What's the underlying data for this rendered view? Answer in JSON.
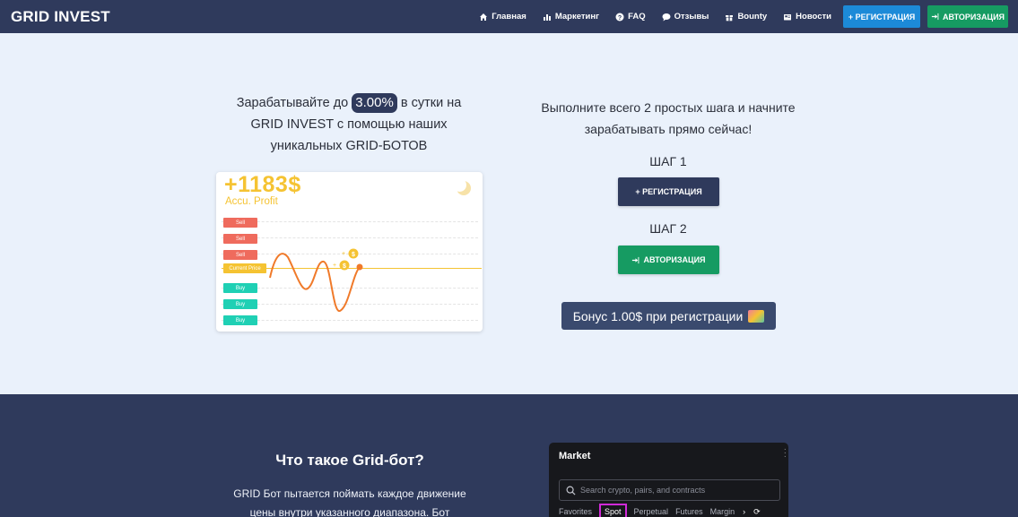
{
  "navbar": {
    "brand": "GRID INVEST",
    "links": [
      {
        "label": "Главная",
        "icon": "home-icon"
      },
      {
        "label": "Маркетинг",
        "icon": "bar-chart-icon"
      },
      {
        "label": "FAQ",
        "icon": "question-icon"
      },
      {
        "label": "Отзывы",
        "icon": "comment-icon"
      },
      {
        "label": "Bounty",
        "icon": "gift-icon"
      },
      {
        "label": "Новости",
        "icon": "newspaper-icon"
      }
    ],
    "register_label": "+ РЕГИСТРАЦИЯ",
    "login_label": "АВТОРИЗАЦИЯ"
  },
  "hero": {
    "earn_prefix": "Зарабатывайте до",
    "earn_percent": "3.00%",
    "earn_suffix": "в сутки на",
    "earn_line2": "GRID INVEST с помощью наших",
    "earn_line3": "уникальных GRID-БОТОВ",
    "steps_line1": "Выполните всего 2 простых шага и начните",
    "steps_line2": "зарабатывать прямо сейчас!",
    "step1_label": "ШАГ 1",
    "step1_button": "+ РЕГИСТРАЦИЯ",
    "step2_label": "ШАГ 2",
    "step2_button": "АВТОРИЗАЦИЯ",
    "bonus": "Бонус 1.00$ при регистрации"
  },
  "bot_card": {
    "profit": "+1183$",
    "profit_label": "Accu. Profit",
    "sell_tag": "Sell",
    "current_tag": "Current Price",
    "buy_tag": "Buy",
    "coin_symbol": "$"
  },
  "grid_section": {
    "title": "Что такое Grid-бот?",
    "desc_line1": "GRID Бот пытается поймать каждое движение",
    "desc_line2": "цены внутри указанного диапазона. Бот"
  },
  "market_widget": {
    "title": "Market",
    "search_placeholder": "Search crypto, pairs, and contracts",
    "tabs": [
      "Favorites",
      "Spot",
      "Perpetual",
      "Futures",
      "Margin"
    ]
  },
  "colors": {
    "navbar": "#2f3a5c",
    "register_blue": "#1c8ad8",
    "login_green": "#169b62",
    "hero_bg": "#eaf1fb",
    "profit_yellow": "#f5c332",
    "sell_red": "#ef6b5d",
    "buy_teal": "#1fd0b4",
    "spot_highlight": "#d12ad8"
  }
}
